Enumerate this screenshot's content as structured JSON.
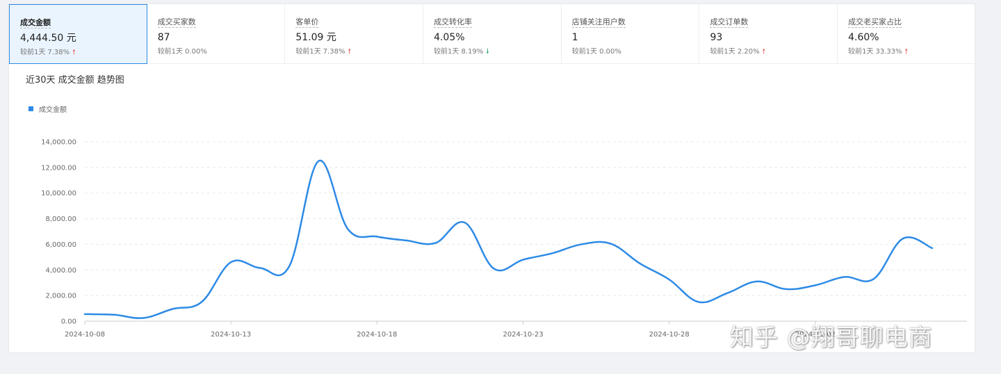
{
  "metrics": [
    {
      "label": "成交金额",
      "value": "4,444.50 元",
      "compare_label": "较前1天",
      "pct": "7.38%",
      "trend": "up",
      "active": true
    },
    {
      "label": "成交买家数",
      "value": "87",
      "compare_label": "较前1天",
      "pct": "0.00%",
      "trend": "none",
      "active": false
    },
    {
      "label": "客单价",
      "value": "51.09 元",
      "compare_label": "较前1天",
      "pct": "7.38%",
      "trend": "up",
      "active": false
    },
    {
      "label": "成交转化率",
      "value": "4.05%",
      "compare_label": "较前1天",
      "pct": "8.19%",
      "trend": "down",
      "active": false
    },
    {
      "label": "店铺关注用户数",
      "value": "1",
      "compare_label": "较前1天",
      "pct": "0.00%",
      "trend": "none",
      "active": false
    },
    {
      "label": "成交订单数",
      "value": "93",
      "compare_label": "较前1天",
      "pct": "2.20%",
      "trend": "up",
      "active": false
    },
    {
      "label": "成交老买家占比",
      "value": "4.60%",
      "compare_label": "较前1天",
      "pct": "33.33%",
      "trend": "up",
      "active": false
    }
  ],
  "chart": {
    "title": "近30天 成交金额 趋势图",
    "legend": "成交金额"
  },
  "colors": {
    "accent": "#2d8ae6",
    "up": "#e84f4f",
    "down": "#1aa260"
  },
  "chart_data": {
    "type": "line",
    "title": "近30天 成交金额 趋势图",
    "x": [
      "2024-10-08",
      "2024-10-09",
      "2024-10-10",
      "2024-10-11",
      "2024-10-12",
      "2024-10-13",
      "2024-10-14",
      "2024-10-15",
      "2024-10-16",
      "2024-10-17",
      "2024-10-18",
      "2024-10-19",
      "2024-10-20",
      "2024-10-21",
      "2024-10-22",
      "2024-10-23",
      "2024-10-24",
      "2024-10-25",
      "2024-10-26",
      "2024-10-27",
      "2024-10-28",
      "2024-10-29",
      "2024-10-30",
      "2024-10-31",
      "2024-11-01",
      "2024-11-02",
      "2024-11-03",
      "2024-11-04"
    ],
    "x_ticks": [
      "2024-10-08",
      "2024-10-13",
      "2024-10-18",
      "2024-10-23",
      "2024-10-28",
      "2024-11-02"
    ],
    "series": [
      {
        "name": "成交金额",
        "values": [
          550,
          500,
          250,
          950,
          1500,
          4600,
          4150,
          4300,
          12500,
          7200,
          6600,
          6300,
          6100,
          7700,
          4100,
          4800,
          5300,
          6000,
          6050,
          4500,
          3250,
          1500,
          2200,
          3100,
          2500,
          2800,
          3450,
          3300,
          6450,
          5700
        ]
      }
    ],
    "ylim": [
      0,
      14000
    ],
    "y_ticks": [
      "0.00",
      "2,000.00",
      "4,000.00",
      "6,000.00",
      "8,000.00",
      "10,000.00",
      "12,000.00",
      "14,000.00"
    ],
    "grid": true,
    "legend_position": "top-left"
  },
  "watermark": "知乎 @翔哥聊电商"
}
